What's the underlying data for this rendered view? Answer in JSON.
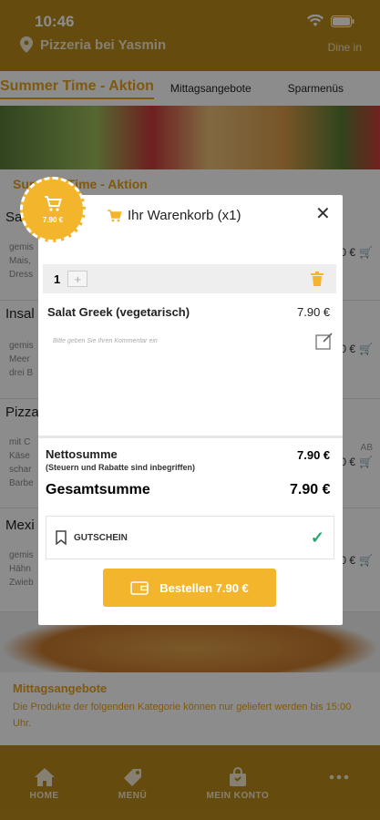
{
  "status": {
    "time": "10:46"
  },
  "header": {
    "restaurant": "Pizzeria bei Yasmin",
    "mode": "Dine in"
  },
  "tabs": [
    {
      "label": "Summer Time - Aktion"
    },
    {
      "label": "Mittagsangebote"
    },
    {
      "label": "Sparmenüs"
    }
  ],
  "section_title": "Summer Time - Aktion",
  "menu_rows": [
    {
      "name": "Sa",
      "desc": [
        "gemis",
        "Mais,",
        "Dress"
      ],
      "price": "0 €"
    },
    {
      "name": "Insal",
      "desc": [
        "gemis",
        "Meer",
        "drei B"
      ],
      "price": "0 €"
    },
    {
      "name": "Pizza",
      "desc": [
        "mit C",
        "Käse",
        "schar",
        "Barbe"
      ],
      "price": "0 €",
      "extra": "AB"
    },
    {
      "name": "Mexi",
      "desc": [
        "gemis",
        "Hähn",
        "Zwieb"
      ],
      "price": "0 €"
    }
  ],
  "mittag": {
    "title": "Mittagsangebote",
    "text": "Die Produkte der folgenden Kategorie können nur geliefert werden bis 15:00 Uhr."
  },
  "bottom_nav": [
    {
      "label": "HOME"
    },
    {
      "label": "MENÜ"
    },
    {
      "label": "MEIN KONTO"
    },
    {
      "label": ""
    }
  ],
  "cart": {
    "badge_total": "7.90 €",
    "title": "Ihr Warenkorb (x1)",
    "quantity": "1",
    "plus": "+",
    "item_name": "Salat Greek (vegetarisch)",
    "item_price": "7.90 €",
    "comment_placeholder": "Bitte geben Sie Ihren Kommentar ein",
    "netto_label": "Nettosumme",
    "netto_note": "(Steuern und Rabatte sind inbegriffen)",
    "netto_value": "7.90 €",
    "gesamt_label": "Gesamtsumme",
    "gesamt_value": "7.90 €",
    "voucher_label": "GUTSCHEIN",
    "order_button": "Bestellen 7.90 €"
  },
  "colors": {
    "brand": "#b98a1b",
    "accent": "#f2b52b",
    "success": "#27a36b"
  }
}
